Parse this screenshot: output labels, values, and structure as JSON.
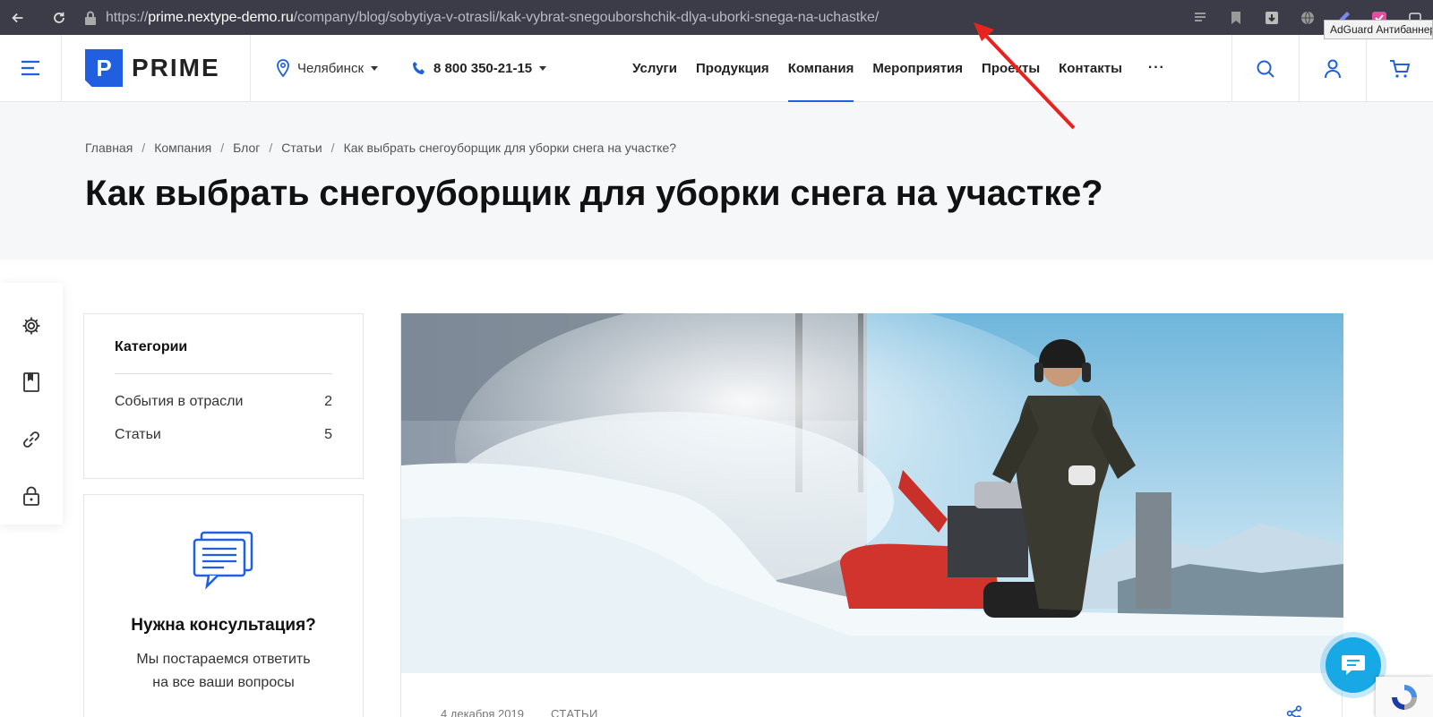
{
  "browser": {
    "url_scheme": "https://",
    "url_host": "prime.nextype-demo.ru",
    "url_path": "/company/blog/sobytiya-v-otrasli/kak-vybrat-snegouborshchik-dlya-uborki-snega-na-uchastke/",
    "tooltip": "AdGuard Антибаннер"
  },
  "header": {
    "logo_letter": "P",
    "logo_text": "PRIME",
    "city": "Челябинск",
    "phone": "8 800 350-21-15",
    "nav": [
      {
        "label": "Услуги",
        "active": false
      },
      {
        "label": "Продукция",
        "active": false
      },
      {
        "label": "Компания",
        "active": true
      },
      {
        "label": "Мероприятия",
        "active": false
      },
      {
        "label": "Проекты",
        "active": false
      },
      {
        "label": "Контакты",
        "active": false
      }
    ],
    "more": "···"
  },
  "breadcrumb": [
    "Главная",
    "Компания",
    "Блог",
    "Статьи",
    "Как выбрать снегоуборщик для уборки снега на участке?"
  ],
  "page_title": "Как выбрать снегоуборщик для уборки снега на участке?",
  "categories": {
    "title": "Категории",
    "items": [
      {
        "label": "События в отрасли",
        "count": "2"
      },
      {
        "label": "Статьи",
        "count": "5"
      }
    ]
  },
  "consult": {
    "title": "Нужна консультация?",
    "text_line1": "Мы постараемся ответить",
    "text_line2": "на все ваши вопросы"
  },
  "article": {
    "date": "4 декабря 2019",
    "category": "СТАТЬИ"
  },
  "colors": {
    "accent": "#1f5fe0",
    "annotation": "#e8231e",
    "chat": "#19a8e6"
  }
}
